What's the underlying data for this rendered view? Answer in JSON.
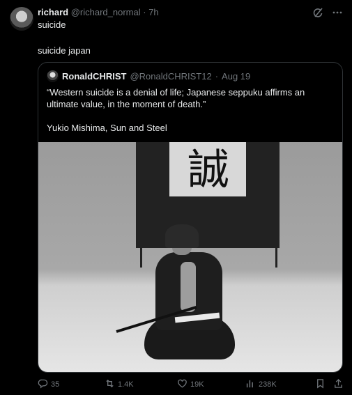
{
  "post": {
    "display_name": "richard",
    "handle": "@richard_normal",
    "separator": "·",
    "time": "7h",
    "reply_text": "suicide",
    "body_text": "suicide japan"
  },
  "quote": {
    "display_name": "RonaldCHRIST",
    "handle": "@RonaldCHRIST12",
    "separator": "·",
    "date": "Aug 19",
    "text": "“Western suicide is a denial of life; Japanese seppuku affirms an ultimate value, in the moment of death.”",
    "attribution": "Yukio Mishima, Sun and Steel",
    "image": {
      "banner_character": "誠"
    }
  },
  "actions": {
    "replies": "35",
    "reposts": "1.4K",
    "likes": "19K",
    "views": "238K"
  },
  "icons": {
    "top": [
      "grok-icon",
      "more-icon"
    ],
    "actions": [
      "reply-icon",
      "repost-icon",
      "like-icon",
      "views-icon",
      "bookmark-icon",
      "share-icon"
    ]
  },
  "colors": {
    "background": "#000000",
    "text": "#e7e9ea",
    "muted": "#71767b",
    "border": "#2f3336"
  }
}
